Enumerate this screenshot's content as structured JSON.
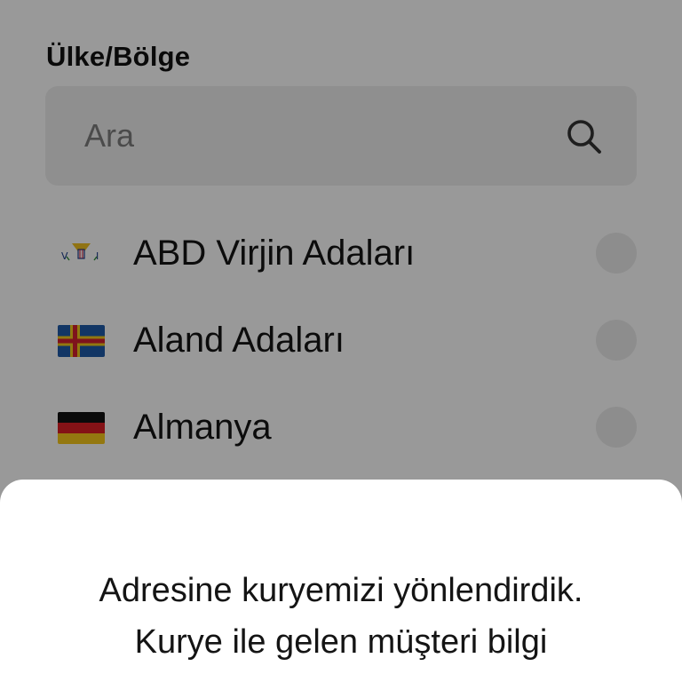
{
  "region_picker": {
    "title": "Ülke/Bölge",
    "search": {
      "placeholder": "Ara",
      "icon": "search-icon"
    },
    "countries": [
      {
        "name": "ABD Virjin Adaları",
        "flag": "us-virgin-islands-flag",
        "selected": false
      },
      {
        "name": "Aland Adaları",
        "flag": "aland-islands-flag",
        "selected": false
      },
      {
        "name": "Almanya",
        "flag": "germany-flag",
        "selected": false
      }
    ]
  },
  "dialog": {
    "message": "Adresine kuryemizi yönlendirdik. Kurye ile gelen müşteri bilgi"
  },
  "colors": {
    "overlay": "#000000",
    "search_background": "#efefef",
    "radio_background": "#ececec",
    "text": "#141414"
  }
}
